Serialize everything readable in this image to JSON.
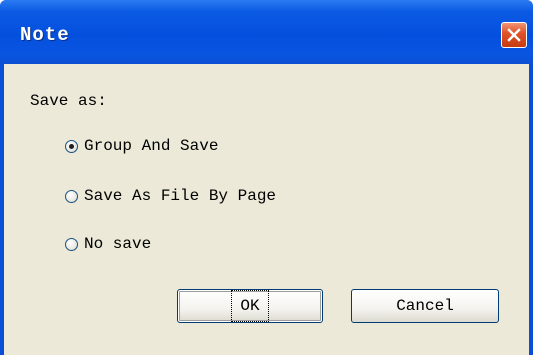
{
  "dialog": {
    "title": "Note",
    "close_icon": "close-icon",
    "prompt": "Save as:",
    "options": [
      {
        "label": "Group And Save",
        "selected": true
      },
      {
        "label": "Save As File By Page",
        "selected": false
      },
      {
        "label": "No save",
        "selected": false
      }
    ],
    "ok_label": "OK",
    "cancel_label": "Cancel"
  },
  "colors": {
    "titlebar": "#0450de",
    "client_bg": "#ece9d8",
    "close_button": "#e2542a"
  }
}
